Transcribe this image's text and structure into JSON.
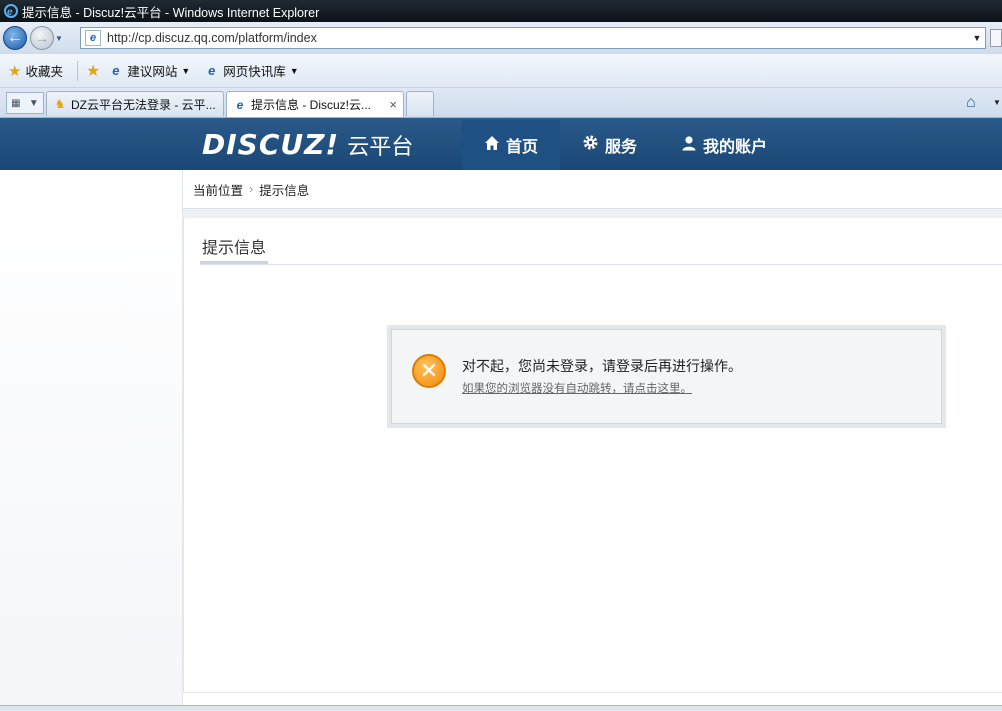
{
  "window": {
    "title": "提示信息 - Discuz!云平台 - Windows Internet Explorer"
  },
  "address_bar": {
    "url": "http://cp.discuz.qq.com/platform/index"
  },
  "favorites_bar": {
    "favorites_label": "收藏夹",
    "items": [
      {
        "label": "建议网站"
      },
      {
        "label": "网页快讯库"
      }
    ]
  },
  "tabs": [
    {
      "label": "DZ云平台无法登录 - 云平...",
      "active": false
    },
    {
      "label": "提示信息 - Discuz!云...",
      "active": true,
      "close": "×"
    }
  ],
  "header": {
    "brand": "DISCUZ!",
    "brand_sub": "云平台",
    "nav": [
      {
        "label": "首页",
        "icon": "home-icon",
        "active": true
      },
      {
        "label": "服务",
        "icon": "gear-icon",
        "active": false
      },
      {
        "label": "我的账户",
        "icon": "user-icon",
        "active": false
      }
    ]
  },
  "breadcrumb": {
    "items": [
      "当前位置",
      "提示信息"
    ]
  },
  "section": {
    "title": "提示信息"
  },
  "message": {
    "text": "对不起，您尚未登录，请登录后再进行操作。",
    "link": "如果您的浏览器没有自动跳转，请点击这里。"
  },
  "colors": {
    "header_bg": "#1a4775",
    "nav_active_bg": "#1e5083",
    "error_icon": "#f08a0c"
  }
}
